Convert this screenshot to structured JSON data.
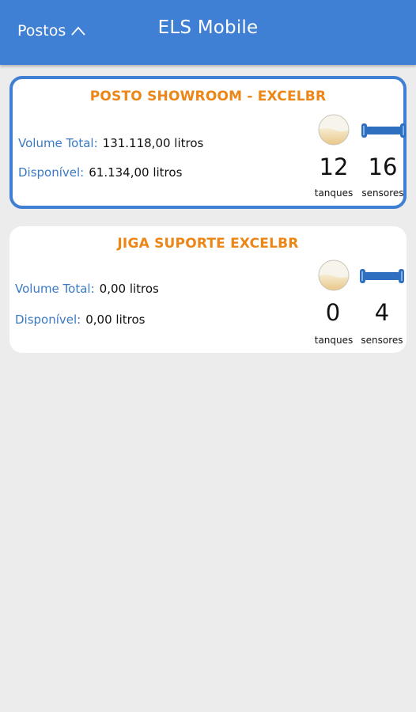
{
  "header": {
    "postos_label": "Postos",
    "app_title": "ELS Mobile"
  },
  "colors": {
    "header": "#3f7fd4",
    "title_orange": "#ec8616",
    "label_blue": "#3a79c4"
  },
  "stations": [
    {
      "name": "POSTO SHOWROOM - EXCELBR",
      "volume_total_label": "Volume Total:",
      "volume_total_value": "131.118,00 litros",
      "disponivel_label": "Disponível:",
      "disponivel_value": "61.134,00 litros",
      "tanques_count": "12",
      "tanques_label": "tanques",
      "sensores_count": "16",
      "sensores_label": "sensores",
      "selected": true
    },
    {
      "name": "JIGA SUPORTE EXCELBR",
      "volume_total_label": "Volume Total:",
      "volume_total_value": "0,00 litros",
      "disponivel_label": "Disponível:",
      "disponivel_value": "0,00 litros",
      "tanques_count": "0",
      "tanques_label": "tanques",
      "sensores_count": "4",
      "sensores_label": "sensores",
      "selected": false
    }
  ],
  "icons": {
    "dropdown": "chevron-up-icon",
    "tank": "tank-level-icon",
    "sensor": "sensor-icon"
  }
}
